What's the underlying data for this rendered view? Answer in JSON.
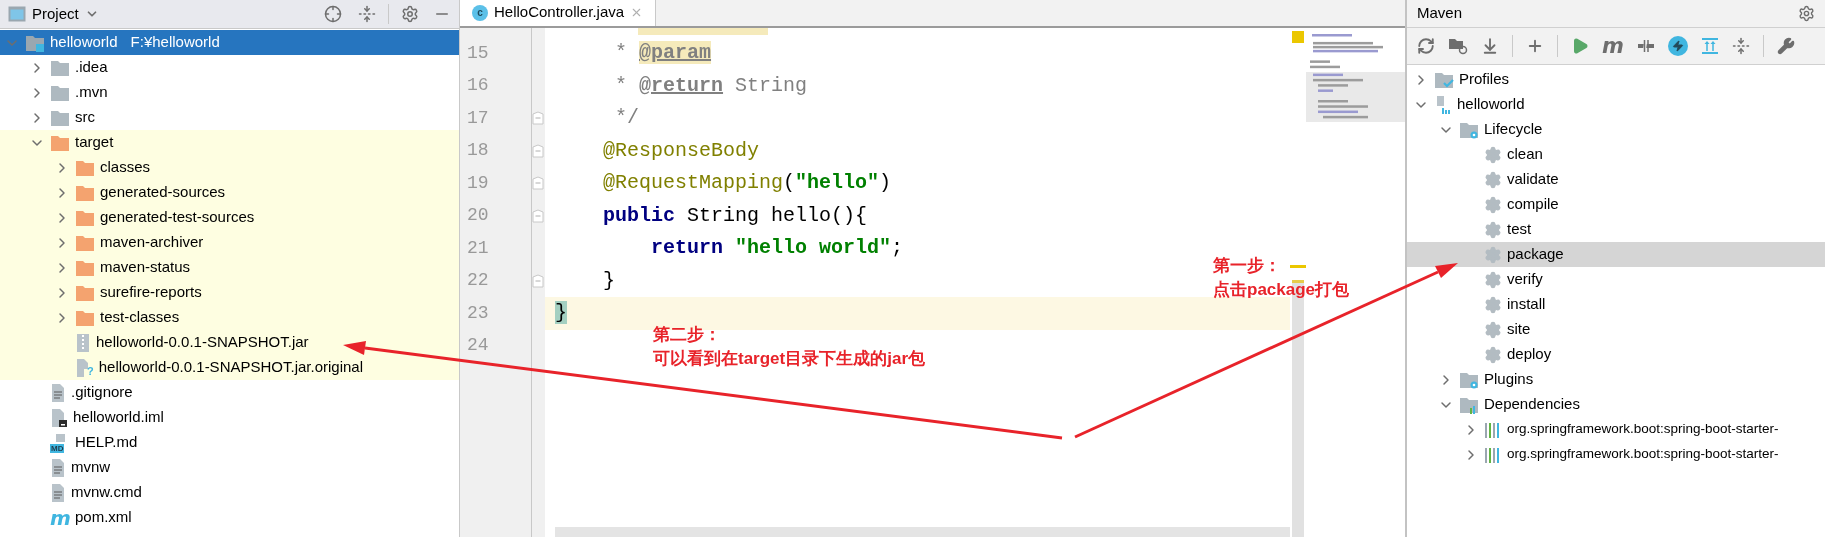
{
  "project": {
    "title": "Project",
    "tree": [
      {
        "name": "helloworld",
        "path": "F:¥helloworld",
        "kind": "module",
        "expanded": true,
        "selected": true,
        "children": [
          {
            "name": ".idea",
            "kind": "folder",
            "expanded": false,
            "selected": false,
            "ignored": false
          },
          {
            "name": ".mvn",
            "kind": "folder",
            "expanded": false,
            "selected": false,
            "ignored": false
          },
          {
            "name": "src",
            "kind": "folder",
            "expanded": false,
            "selected": false,
            "ignored": false
          },
          {
            "name": "target",
            "kind": "folder",
            "expanded": true,
            "selected": false,
            "ignored": true,
            "children": [
              {
                "name": "classes",
                "kind": "folder",
                "expanded": false,
                "selected": false,
                "ignored": true
              },
              {
                "name": "generated-sources",
                "kind": "folder",
                "expanded": false,
                "selected": false,
                "ignored": true
              },
              {
                "name": "generated-test-sources",
                "kind": "folder",
                "expanded": false,
                "selected": false,
                "ignored": true
              },
              {
                "name": "maven-archiver",
                "kind": "folder",
                "expanded": false,
                "selected": false,
                "ignored": true
              },
              {
                "name": "maven-status",
                "kind": "folder",
                "expanded": false,
                "selected": false,
                "ignored": true
              },
              {
                "name": "surefire-reports",
                "kind": "folder",
                "expanded": false,
                "selected": false,
                "ignored": true
              },
              {
                "name": "test-classes",
                "kind": "folder",
                "expanded": false,
                "selected": false,
                "ignored": true
              },
              {
                "name": "helloworld-0.0.1-SNAPSHOT.jar",
                "kind": "jar",
                "selected": false,
                "ignored": true
              },
              {
                "name": "helloworld-0.0.1-SNAPSHOT.jar.original",
                "kind": "unknown",
                "badge": "?",
                "selected": false,
                "ignored": true
              }
            ]
          },
          {
            "name": ".gitignore",
            "kind": "text",
            "selected": false,
            "ignored": false
          },
          {
            "name": "helloworld.iml",
            "kind": "iml",
            "selected": false,
            "ignored": false
          },
          {
            "name": "HELP.md",
            "kind": "markdown",
            "badge": "MD",
            "selected": false,
            "ignored": false
          },
          {
            "name": "mvnw",
            "kind": "text",
            "selected": false,
            "ignored": false
          },
          {
            "name": "mvnw.cmd",
            "kind": "text",
            "selected": false,
            "ignored": false
          },
          {
            "name": "pom.xml",
            "kind": "maven",
            "badge": "m",
            "selected": false,
            "ignored": false
          }
        ]
      }
    ]
  },
  "editor": {
    "tabs": [
      {
        "label": "HelloController.java",
        "badge": "c",
        "selected": true
      }
    ],
    "lines": [
      {
        "number": "15",
        "fold": false,
        "current": false,
        "tokens": [
          {
            "text": "     * ",
            "kind": "comment"
          },
          {
            "text": "@param",
            "kind": "doc_tag",
            "search_hit": true
          }
        ]
      },
      {
        "number": "16",
        "fold": false,
        "current": false,
        "tokens": [
          {
            "text": "     * ",
            "kind": "comment"
          },
          {
            "text": "@return",
            "kind": "doc_tag"
          },
          {
            "text": " String",
            "kind": "comment"
          }
        ]
      },
      {
        "number": "17",
        "fold": true,
        "current": false,
        "tokens": [
          {
            "text": "     */",
            "kind": "comment"
          }
        ]
      },
      {
        "number": "18",
        "fold": true,
        "current": false,
        "tokens": [
          {
            "text": "    @ResponseBody",
            "kind": "annotation"
          }
        ]
      },
      {
        "number": "19",
        "fold": true,
        "current": false,
        "tokens": [
          {
            "text": "    @RequestMapping",
            "kind": "annotation"
          },
          {
            "text": "(",
            "kind": "plain"
          },
          {
            "text": "\"hello\"",
            "kind": "string"
          },
          {
            "text": ")",
            "kind": "plain"
          }
        ]
      },
      {
        "number": "20",
        "fold": true,
        "current": false,
        "tokens": [
          {
            "text": "    public",
            "kind": "keyword"
          },
          {
            "text": " String hello(){",
            "kind": "plain"
          }
        ]
      },
      {
        "number": "21",
        "fold": false,
        "current": false,
        "tokens": [
          {
            "text": "        return ",
            "kind": "keyword"
          },
          {
            "text": "\"hello world\"",
            "kind": "string"
          },
          {
            "text": ";",
            "kind": "plain"
          }
        ]
      },
      {
        "number": "22",
        "fold": true,
        "current": false,
        "tokens": [
          {
            "text": "    }",
            "kind": "plain"
          }
        ]
      },
      {
        "number": "23",
        "fold": false,
        "current": true,
        "tokens": [
          {
            "text": "}",
            "kind": "plain",
            "brace_match": true
          }
        ]
      },
      {
        "number": "24",
        "fold": false,
        "current": false
      }
    ]
  },
  "maven": {
    "title": "Maven",
    "goal_button": "m",
    "tree": [
      {
        "label": "Profiles",
        "kind": "profiles",
        "expanded": false,
        "selected": false
      },
      {
        "label": "helloworld",
        "kind": "project",
        "expanded": true,
        "selected": false,
        "children": [
          {
            "label": "Lifecycle",
            "kind": "lifecycle",
            "expanded": true,
            "selected": false,
            "children": [
              {
                "label": "clean",
                "kind": "goal",
                "selected": false
              },
              {
                "label": "validate",
                "kind": "goal",
                "selected": false
              },
              {
                "label": "compile",
                "kind": "goal",
                "selected": false
              },
              {
                "label": "test",
                "kind": "goal",
                "selected": false
              },
              {
                "label": "package",
                "kind": "goal",
                "selected": true
              },
              {
                "label": "verify",
                "kind": "goal",
                "selected": false
              },
              {
                "label": "install",
                "kind": "goal",
                "selected": false
              },
              {
                "label": "site",
                "kind": "goal",
                "selected": false
              },
              {
                "label": "deploy",
                "kind": "goal",
                "selected": false
              }
            ]
          },
          {
            "label": "Plugins",
            "kind": "plugins",
            "expanded": false,
            "selected": false
          },
          {
            "label": "Dependencies",
            "kind": "dependencies",
            "expanded": true,
            "selected": false,
            "children": [
              {
                "label": "org.springframework.boot:spring-boot-starter-",
                "kind": "dependency",
                "expanded": false,
                "selected": false
              },
              {
                "label": "org.springframework.boot:spring-boot-starter-",
                "kind": "dependency",
                "expanded": false,
                "selected": false
              }
            ]
          }
        ]
      }
    ]
  },
  "annotations": [
    {
      "lines": [
        "第二步：",
        "可以看到在target目录下生成的jar包"
      ]
    },
    {
      "lines": [
        "第一步：",
        "点击package打包"
      ]
    }
  ]
}
